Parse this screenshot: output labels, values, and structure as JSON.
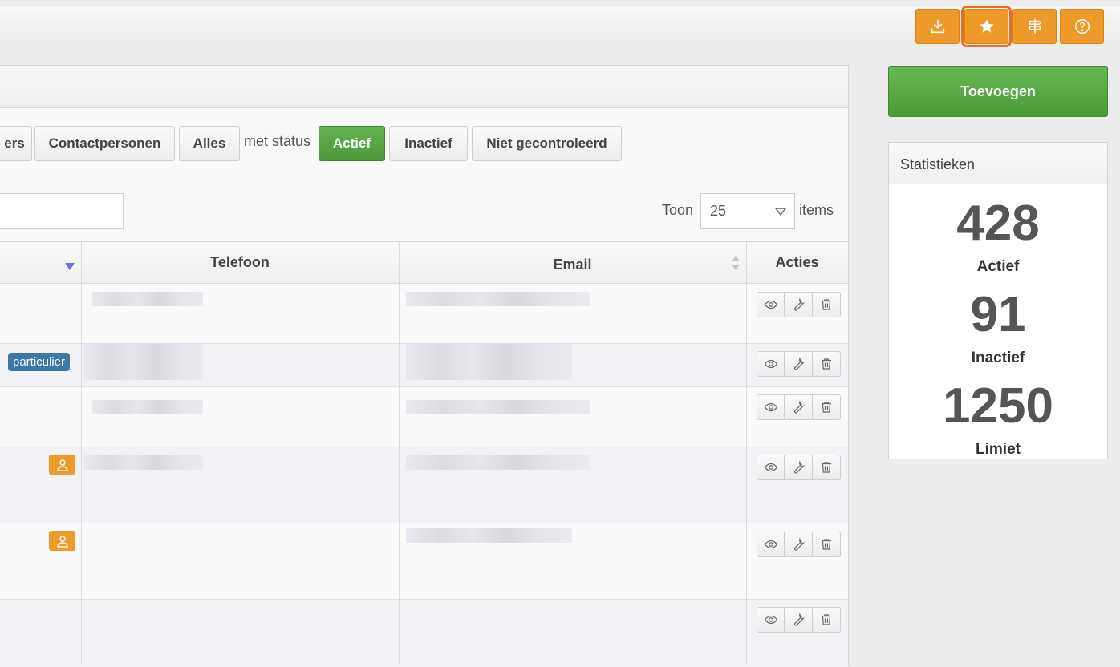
{
  "toolbar": {
    "buttons": [
      {
        "name": "download-button",
        "icon": "download-icon"
      },
      {
        "name": "favorite-button",
        "icon": "star-icon",
        "highlighted": true
      },
      {
        "name": "signpost-button",
        "icon": "signpost-icon"
      },
      {
        "name": "help-button",
        "icon": "help-icon"
      }
    ],
    "accent_color": "#ee9a2a"
  },
  "filters": {
    "type_buttons": [
      "ers",
      "Contactpersonen",
      "Alles"
    ],
    "status_label": "met status",
    "status_buttons": [
      {
        "label": "Actief",
        "active": true
      },
      {
        "label": "Inactief",
        "active": false
      },
      {
        "label": "Niet gecontroleerd",
        "active": false
      }
    ]
  },
  "pagination": {
    "toon_label": "Toon",
    "page_size": "25",
    "items_label": "items"
  },
  "table": {
    "columns": [
      "",
      "Telefoon",
      "Email",
      "Acties"
    ],
    "rows": [
      {
        "tag": null,
        "person_badge": false
      },
      {
        "tag": "particulier",
        "person_badge": false
      },
      {
        "tag": null,
        "person_badge": false
      },
      {
        "tag": null,
        "person_badge": true
      },
      {
        "tag": null,
        "person_badge": true
      },
      {
        "tag": null,
        "person_badge": false
      }
    ],
    "row_actions": [
      "view-icon",
      "wrench-icon",
      "trash-icon"
    ]
  },
  "sidebar": {
    "add_label": "Toevoegen",
    "stats_title": "Statistieken",
    "stats": [
      {
        "value": "428",
        "label": "Actief"
      },
      {
        "value": "91",
        "label": "Inactief"
      },
      {
        "value": "1250",
        "label": "Limiet"
      }
    ]
  },
  "colors": {
    "green": "#4d9a3c",
    "blue_tag": "#3b78a8",
    "orange": "#ee9a2a",
    "highlight": "#f26a2a"
  }
}
